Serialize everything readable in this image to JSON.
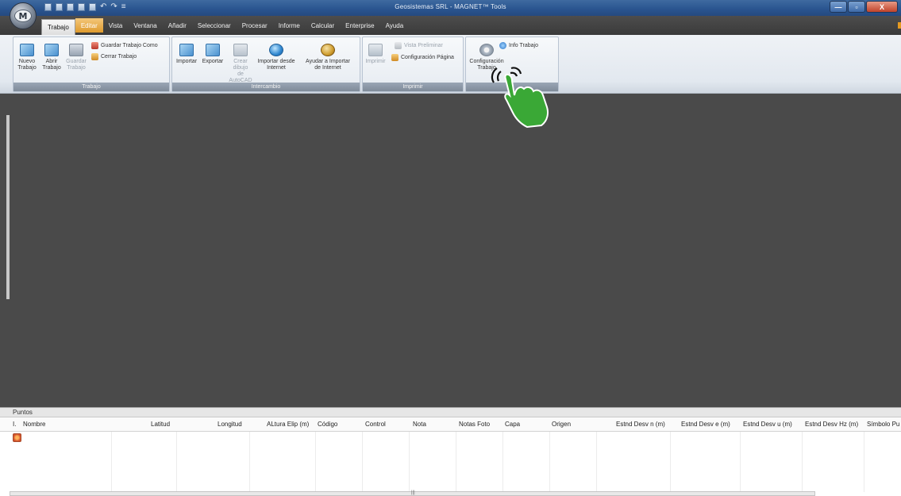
{
  "window": {
    "title": "Geosistemas SRL - MAGNET™ Tools",
    "app_logo": "M",
    "minimize_label": "—",
    "maximize_label": "▫",
    "close_label": "X"
  },
  "menu": {
    "items": [
      "Trabajo",
      "Editar",
      "Vista",
      "Ventana",
      "Añadir",
      "Seleccionar",
      "Procesar",
      "Informe",
      "Calcular",
      "Enterprise",
      "Ayuda"
    ]
  },
  "ribbon": {
    "groups": {
      "trabajo": {
        "label": "Trabajo",
        "nuevo": [
          "Nuevo",
          "Trabajo"
        ],
        "abrir": [
          "Abrir",
          "Trabajo"
        ],
        "guardar": [
          "Guardar",
          "Trabajo"
        ],
        "guardar_como": "Guardar Trabajo Como",
        "cerrar": "Cerrar Trabajo"
      },
      "intercambio": {
        "label": "Intercambio",
        "importar": "Importar",
        "exportar": "Exportar",
        "crear_dibujo": [
          "Crear dibujo",
          "de AutoCAD"
        ],
        "importar_internet": [
          "Importar desde",
          "Internet"
        ],
        "ayudar_importar": [
          "Ayudar a Importar",
          "de Internet"
        ]
      },
      "imprimir": {
        "label": "Imprimir",
        "imprimir": "Imprimir",
        "vista_preliminar": "Vista Preliminar",
        "config_pagina": "Configuración Página"
      },
      "config": {
        "label": "",
        "configuracion": [
          "Configuración",
          "Trabajo"
        ],
        "info": "Info Trabajo"
      }
    }
  },
  "panel": {
    "title": "Puntos",
    "columns": [
      "I.",
      "Nombre",
      "Latitud",
      "Longitud",
      "ALtura Elip (m)",
      "Código",
      "Control",
      "Nota",
      "Notas Foto",
      "Capa",
      "Origen",
      "Estnd Desv n (m)",
      "Estnd Desv e (m)",
      "Estnd Desv u (m)",
      "Estnd Desv Hz (m)",
      "Símbolo Pu"
    ],
    "scroll_mark": "|||"
  },
  "colors": {
    "workspace": "#4a4a4a",
    "menubar": "#3a3a3a",
    "editar_tab": "#de9a2e",
    "pointer_hand": "#3aa836"
  }
}
